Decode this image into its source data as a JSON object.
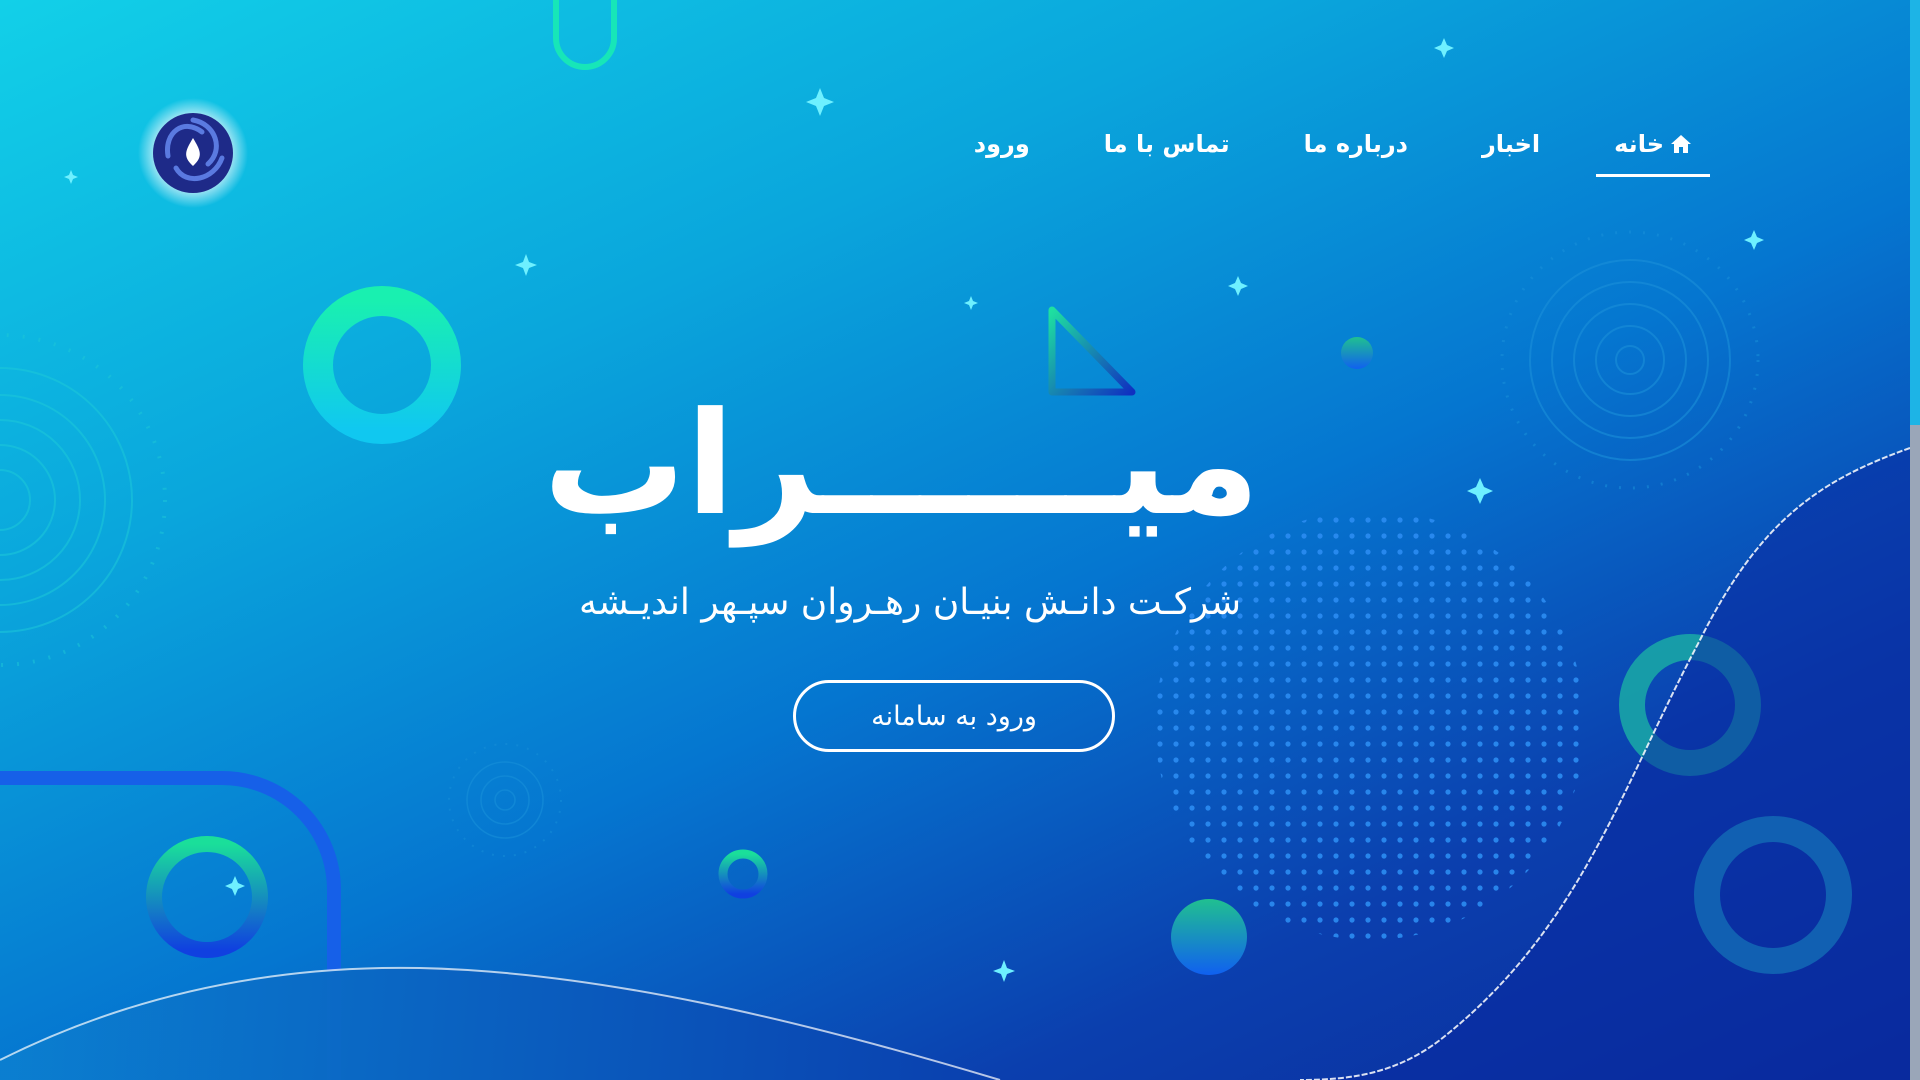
{
  "brand": {
    "logo_icon": "swirl-water-drop-logo-icon"
  },
  "nav": {
    "items": [
      {
        "label": "خانه",
        "icon": "home-icon",
        "active": true
      },
      {
        "label": "اخبار",
        "active": false
      },
      {
        "label": "درباره ما",
        "active": false
      },
      {
        "label": "تماس با ما",
        "active": false
      },
      {
        "label": "ورود",
        "active": false
      }
    ]
  },
  "hero": {
    "title": "میــــــراب",
    "subtitle": "شرکـت دانـش بنیـان رهـروان سپـهر اندیـشه",
    "cta_label": "ورود به سامانه"
  },
  "colors": {
    "bg_top": "#12d0e8",
    "bg_bottom": "#0a2a9a",
    "accent_green": "#19e8a8",
    "text": "#ffffff"
  }
}
